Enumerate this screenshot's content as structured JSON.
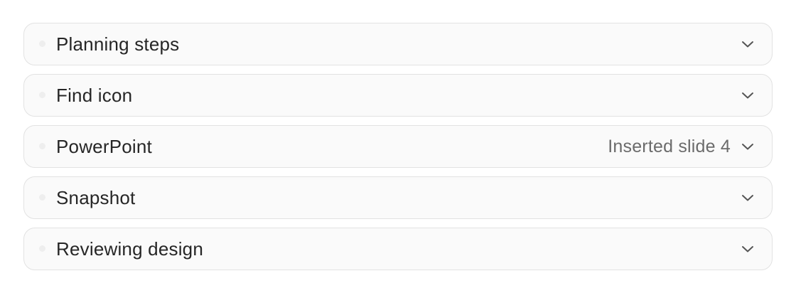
{
  "steps": [
    {
      "label": "Planning steps",
      "status": ""
    },
    {
      "label": "Find icon",
      "status": ""
    },
    {
      "label": "PowerPoint",
      "status": "Inserted slide 4"
    },
    {
      "label": "Snapshot",
      "status": ""
    },
    {
      "label": "Reviewing design",
      "status": ""
    }
  ],
  "icons": {
    "expand": "chevron-down-icon",
    "bullet": "status-dot-icon"
  },
  "colors": {
    "row_background": "#fafafa",
    "row_border": "#e2e2e2",
    "label_text": "#262626",
    "status_text": "#6b6b6b"
  }
}
